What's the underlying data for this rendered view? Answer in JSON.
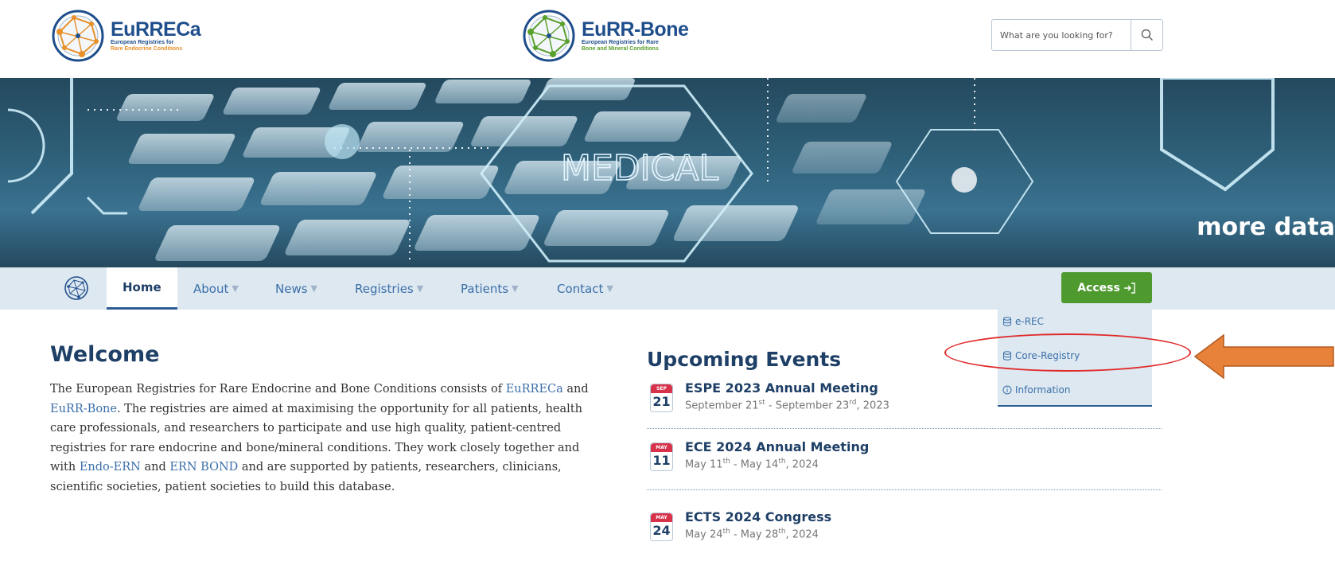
{
  "header": {
    "logo_left": {
      "title": "EuRRECa",
      "subtitle_line1": "European Registries for",
      "subtitle_line2": "Rare Endocrine Conditions"
    },
    "logo_mid": {
      "title": "EuRR-Bone",
      "subtitle_line1": "European Registries for Rare",
      "subtitle_line2": "Bone and Mineral Conditions"
    },
    "search": {
      "placeholder": "What are you looking for?",
      "icon": "search-icon"
    }
  },
  "banner": {
    "text": "more data",
    "overlay_word": "MEDICAL"
  },
  "nav": {
    "items": [
      {
        "label": "Home",
        "active": true
      },
      {
        "label": "About",
        "active": false
      },
      {
        "label": "News",
        "active": false
      },
      {
        "label": "Registries",
        "active": false
      },
      {
        "label": "Patients",
        "active": false
      },
      {
        "label": "Contact",
        "active": false
      }
    ],
    "access_label": "Access",
    "access_icon": "login-icon"
  },
  "access_menu": {
    "items": [
      {
        "label": "e-REC",
        "icon": "database-icon"
      },
      {
        "label": "Core-Registry",
        "icon": "database-icon"
      },
      {
        "label": "Information",
        "icon": "info-icon"
      }
    ]
  },
  "annotation": {
    "ellipse_color": "#e02a2a",
    "arrow_color": "#e8823a"
  },
  "welcome": {
    "title": "Welcome",
    "p1": "The European Registries for Rare Endocrine and Bone Conditions consists of",
    "link1": "EuRRECa",
    "and1": " and ",
    "link2": "EuRR-Bone",
    "p2": ". The registries are aimed at maximising the opportunity for all patients, health care professionals, and researchers to participate and use high quality, patient-centred registries for rare endocrine and bone/mineral conditions. They work closely together and with ",
    "link3": "Endo-ERN",
    "and2": " and ",
    "link4": "ERN BOND",
    "p3": " and are supported by patients, researchers, clinicians, scientific societies, patient societies to build this database."
  },
  "events": {
    "title": "Upcoming Events",
    "items": [
      {
        "month": "SEP",
        "day": "21",
        "title": "ESPE 2023 Annual Meeting",
        "d1": "September 21",
        "s1": "st",
        "mid": " - September 23",
        "s2": "rd",
        "end": ", 2023"
      },
      {
        "month": "MAY",
        "day": "11",
        "title": "ECE 2024 Annual Meeting",
        "d1": "May 11",
        "s1": "th",
        "mid": " - May 14",
        "s2": "th",
        "end": ", 2024"
      },
      {
        "month": "MAY",
        "day": "24",
        "title": "ECTS 2024 Congress",
        "d1": "May 24",
        "s1": "th",
        "mid": " - May 28",
        "s2": "th",
        "end": ", 2024"
      }
    ]
  },
  "colors": {
    "primary": "#1e3f66",
    "link": "#3b6fa8",
    "access_green": "#4e9a2f",
    "nav_bg": "#dde8f1",
    "calendar_red": "#d8314a"
  }
}
